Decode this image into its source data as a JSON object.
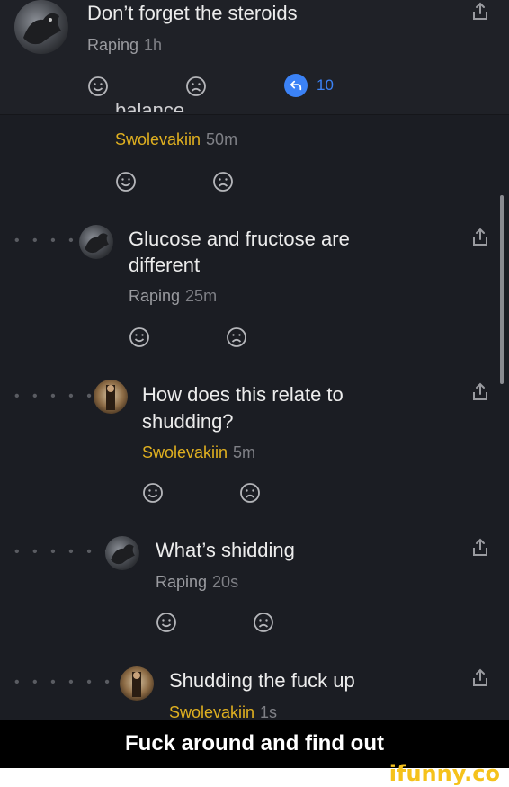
{
  "header_post": {
    "title": "Don’t forget the steroids",
    "username": "Raping",
    "time": "1h",
    "reply_count": "10"
  },
  "cut_off_text": "balance",
  "comments": [
    {
      "text_lines": [],
      "username": "Swolevakiin",
      "time": "50m"
    },
    {
      "text_lines": [
        "Glucose and fructose are",
        "different"
      ],
      "username": "Raping",
      "time": "25m"
    },
    {
      "text_lines": [
        "How does this relate to",
        "shudding?"
      ],
      "username": "Swolevakiin",
      "time": "5m"
    },
    {
      "text_lines": [
        "What’s shidding"
      ],
      "username": "Raping",
      "time": "20s"
    },
    {
      "text_lines": [
        "Shudding the fuck up"
      ],
      "username": "Swolevakiin",
      "time": "1s"
    }
  ],
  "thread_dots": [
    "• • • •",
    "• • • • •",
    "• • • • • •",
    "• • • • • • •"
  ],
  "caption": "Fuck around and find out",
  "watermark": "ifunny.co",
  "colors": {
    "accent_blue": "#3b82f6",
    "username_yellow": "#e0b020",
    "background": "#1b1d23"
  }
}
